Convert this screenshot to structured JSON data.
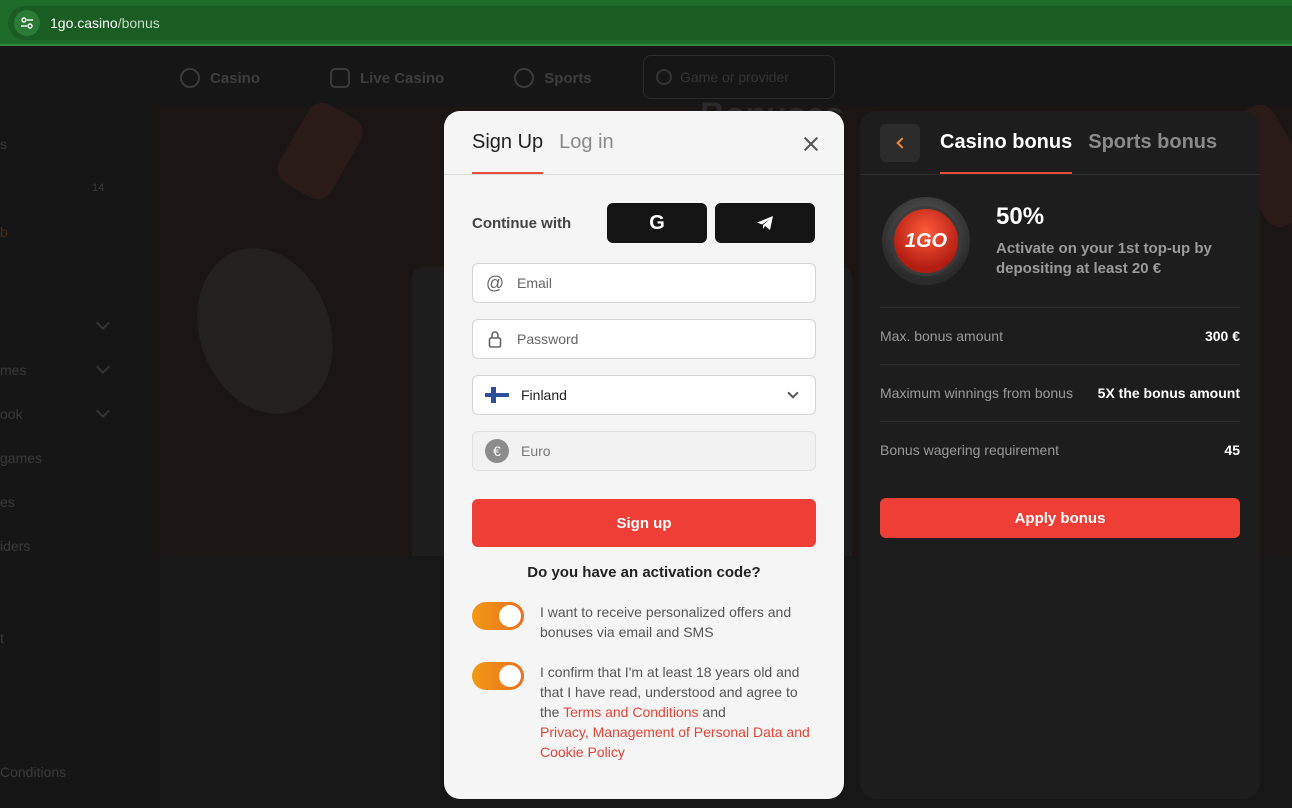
{
  "browser": {
    "url_host": "1go.casino",
    "url_path": "/bonus"
  },
  "background": {
    "nav": [
      "Casino",
      "Live Casino",
      "Sports"
    ],
    "search_placeholder": "Game or provider",
    "hero_title": "Bonuses",
    "sidebar_fragments": [
      "s",
      "14",
      "b",
      "mes",
      "ook",
      "games",
      "es",
      "iders",
      "t",
      "Conditions"
    ]
  },
  "signup": {
    "tabs": [
      "Sign Up",
      "Log in"
    ],
    "continue_label": "Continue with",
    "google_label": "G",
    "email_placeholder": "Email",
    "password_placeholder": "Password",
    "country": "Finland",
    "currency": "Euro",
    "signup_button": "Sign up",
    "activation_question": "Do you have an activation code?",
    "offers_consent": "I want to receive personalized offers and bonuses via email and SMS",
    "age_consent_prefix": "I confirm that I'm at least 18 years old and that I have read, understood and agree to the ",
    "terms_link": "Terms and Conditions",
    "age_consent_and": " and ",
    "privacy_link": "Privacy, Management of Personal Data and Cookie Policy"
  },
  "bonus": {
    "tabs": [
      "Casino bonus",
      "Sports bonus"
    ],
    "logo_text": "1GO",
    "percent": "50%",
    "description": "Activate on your 1st top-up by depositing at least 20 €",
    "rows": [
      {
        "label": "Max. bonus amount",
        "value": "300 €"
      },
      {
        "label": "Maximum winnings from bonus",
        "value": "5X the bonus amount"
      },
      {
        "label": "Bonus wagering requirement",
        "value": "45"
      }
    ],
    "apply_button": "Apply bonus"
  },
  "colors": {
    "accent_red": "#ee3e35",
    "toggle_orange": "#f39a13",
    "browser_green": "#1f6b2a"
  }
}
